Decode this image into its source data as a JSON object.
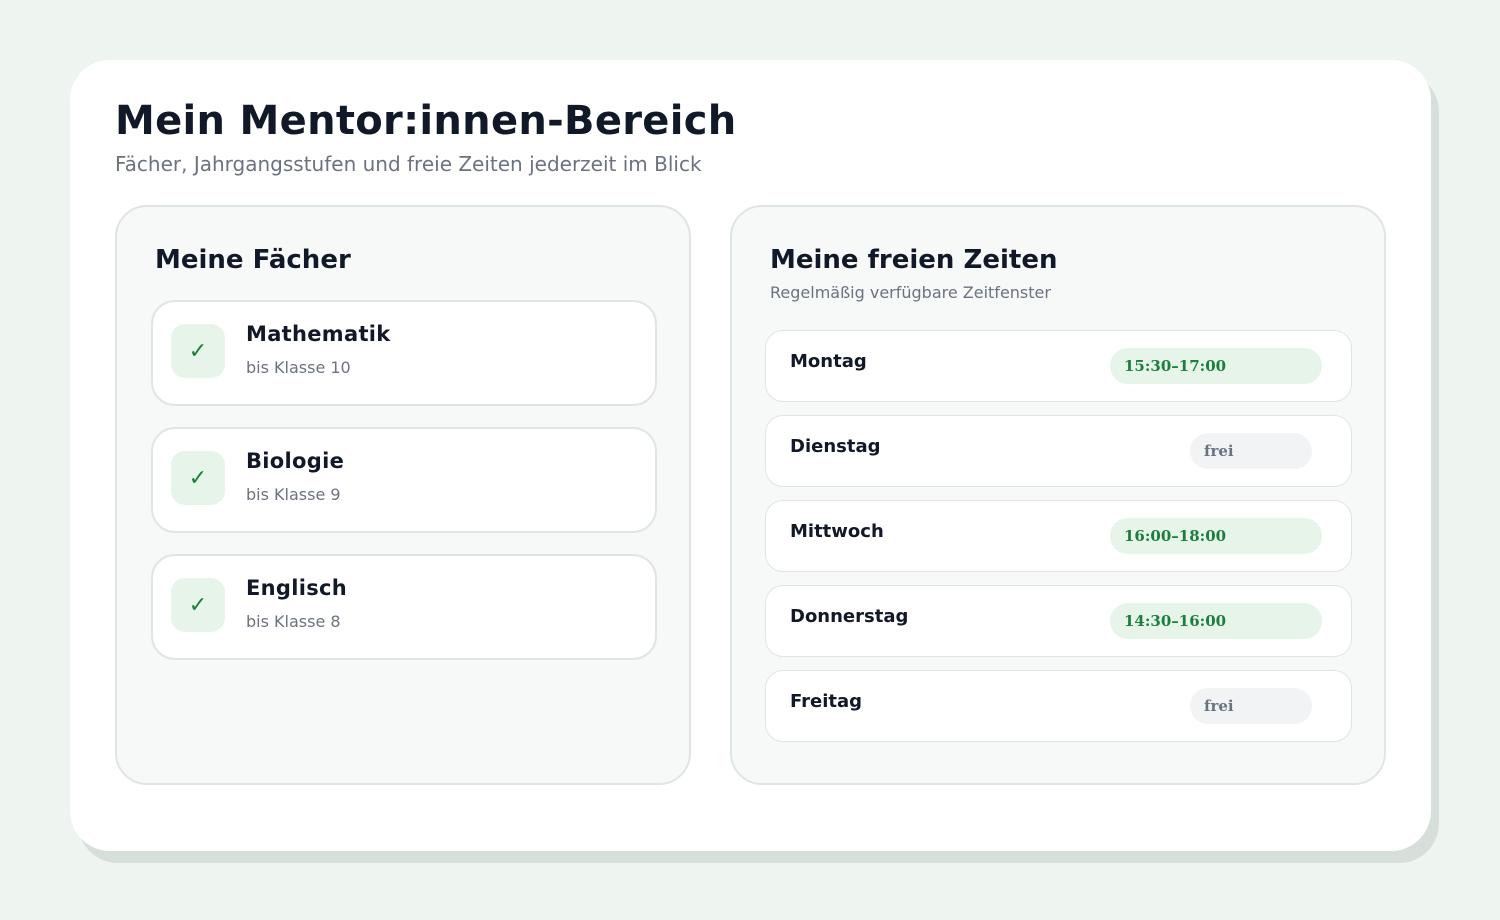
{
  "header": {
    "title": "Mein Mentor:innen-Bereich",
    "subtitle": "Fächer, Jahrgangsstufen und freie Zeiten jederzeit im Blick"
  },
  "subjects_panel": {
    "title": "Meine Fächer",
    "check_glyph": "✓",
    "items": [
      {
        "name": "Mathematik",
        "level": "bis Klasse 10",
        "checked": true
      },
      {
        "name": "Biologie",
        "level": "bis Klasse 9",
        "checked": true
      },
      {
        "name": "Englisch",
        "level": "bis Klasse 8",
        "checked": true
      }
    ]
  },
  "availability_panel": {
    "title": "Meine freien Zeiten",
    "subtitle": "Regelmäßig verfügbare Zeitfenster",
    "days": [
      {
        "day": "Montag",
        "slot": "15:30–17:00",
        "status": "time"
      },
      {
        "day": "Dienstag",
        "slot": "frei",
        "status": "free"
      },
      {
        "day": "Mittwoch",
        "slot": "16:00–18:00",
        "status": "time"
      },
      {
        "day": "Donnerstag",
        "slot": "14:30–16:00",
        "status": "time"
      },
      {
        "day": "Freitag",
        "slot": "frei",
        "status": "free"
      }
    ]
  },
  "colors": {
    "accent_green": "#1a7f3c",
    "green_bg": "#e6f4ea",
    "page_bg": "#eef4f0",
    "text_dark": "#111827",
    "text_muted": "#6b7280"
  }
}
